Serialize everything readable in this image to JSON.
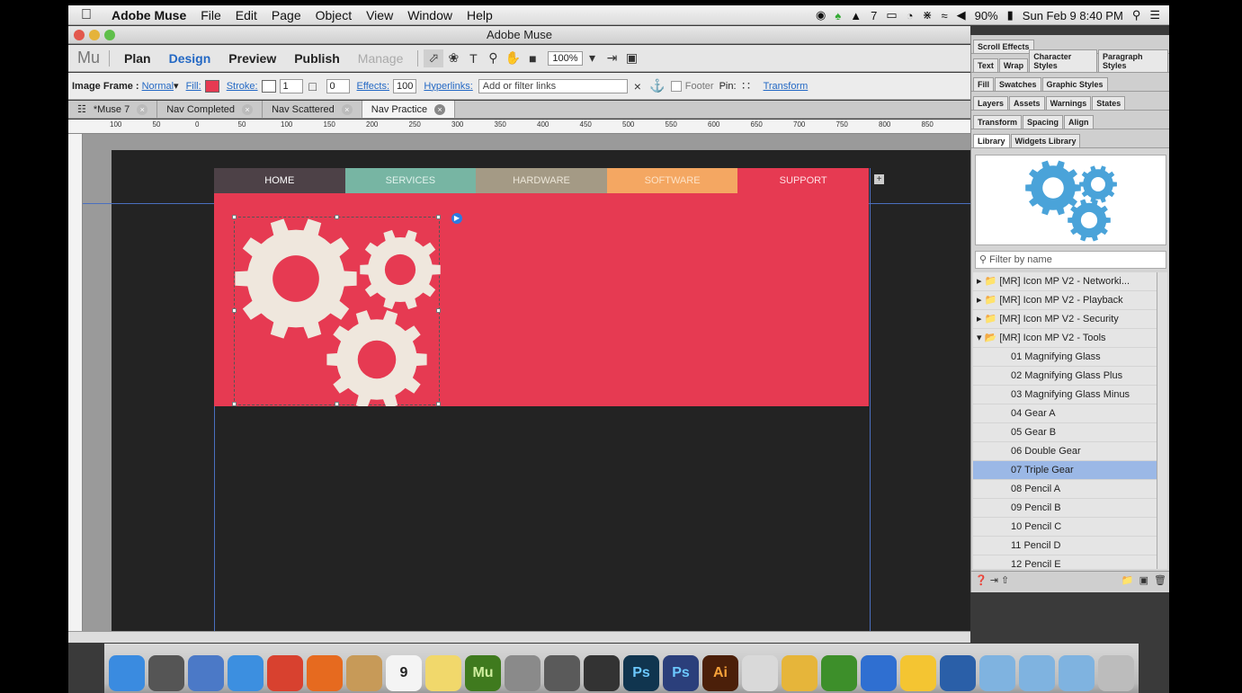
{
  "menubar": {
    "app_name": "Adobe Muse",
    "items": [
      "File",
      "Edit",
      "Page",
      "Object",
      "View",
      "Window",
      "Help"
    ],
    "status_text": "7",
    "battery": "90%",
    "clock": "Sun Feb 9  8:40 PM"
  },
  "window": {
    "title": "Adobe Muse"
  },
  "appbar": {
    "logo": "Mu",
    "tabs": [
      "Plan",
      "Design",
      "Preview",
      "Publish",
      "Manage"
    ],
    "zoom": "100%"
  },
  "ctrlbar": {
    "image_frame_label": "Image Frame :",
    "normal": "Normal",
    "fill": "Fill:",
    "stroke": "Stroke:",
    "stroke_value": "1",
    "corner_value": "0",
    "effects": "Effects:",
    "opacity": "100",
    "hyperlinks": "Hyperlinks:",
    "hyperlinks_placeholder": "Add or filter links",
    "footer": "Footer",
    "pin": "Pin:",
    "transform": "Transform"
  },
  "doctabs": [
    "*Muse 7",
    "Nav Completed",
    "Nav Scattered",
    "Nav Practice"
  ],
  "ruler_labels": [
    "100",
    "50",
    "0",
    "50",
    "100",
    "150",
    "200",
    "250",
    "300",
    "350",
    "400",
    "450",
    "500",
    "550",
    "600",
    "650",
    "700",
    "750",
    "800",
    "850"
  ],
  "site_nav": [
    {
      "label": "HOME",
      "color": "#4d4147",
      "text_color": "#ffffff"
    },
    {
      "label": "SERVICES",
      "color": "#77b5a3",
      "text_color": "#e0f2ec"
    },
    {
      "label": "HARDWARE",
      "color": "#a49a85",
      "text_color": "#ece6d8"
    },
    {
      "label": "SOFTWARE",
      "color": "#f4a762",
      "text_color": "#fde2c6"
    },
    {
      "label": "SUPPORT",
      "color": "#e63a52",
      "text_color": "#ffe0e4"
    }
  ],
  "colors": {
    "hero": "#e63a52",
    "gear": "#efe7dd",
    "preview_gear": "#4aa3d9",
    "selection": "#9bb8e6"
  },
  "panel": {
    "row1": [
      "Scroll Effects"
    ],
    "row2": [
      "Text",
      "Wrap",
      "Character Styles",
      "Paragraph Styles"
    ],
    "row3": [
      "Fill",
      "Swatches",
      "Graphic Styles"
    ],
    "row4": [
      "Layers",
      "Assets",
      "Warnings",
      "States"
    ],
    "row5": [
      "Transform",
      "Spacing",
      "Align"
    ],
    "row6": [
      "Library",
      "Widgets Library"
    ],
    "filter_placeholder": "Filter by name",
    "folders": [
      "[MR] Icon MP V2 - Networki...",
      "[MR] Icon MP V2 - Playback",
      "[MR] Icon MP V2 - Security",
      "[MR] Icon MP V2 - Tools"
    ],
    "items": [
      "01 Magnifying Glass",
      "02 Magnifying Glass Plus",
      "03 Magnifying Glass Minus",
      "04 Gear A",
      "05 Gear B",
      "06 Double Gear",
      "07 Triple Gear",
      "08 Pencil A",
      "09 Pencil B",
      "10 Pencil C",
      "11 Pencil D",
      "12 Pencil E"
    ],
    "selected_item": "07 Triple Gear"
  },
  "dock": [
    {
      "icon": "finder-icon",
      "color": "#3a8be0"
    },
    {
      "icon": "launchpad-icon",
      "color": "#555555"
    },
    {
      "icon": "preview-icon",
      "color": "#4b79c7"
    },
    {
      "icon": "safari-icon",
      "color": "#3c8fe0"
    },
    {
      "icon": "chrome-icon",
      "color": "#d8412f"
    },
    {
      "icon": "firefox-icon",
      "color": "#e66a1f"
    },
    {
      "icon": "contacts-icon",
      "color": "#c79a58"
    },
    {
      "icon": "calendar-icon",
      "color": "#f4f4f4"
    },
    {
      "icon": "stickies-icon",
      "color": "#f1d86b"
    },
    {
      "icon": "muse-icon",
      "color": "#3f7a1e"
    },
    {
      "icon": "calculator-icon",
      "color": "#8a8a8a"
    },
    {
      "icon": "final-cut-icon",
      "color": "#5a5a5a"
    },
    {
      "icon": "dvd-icon",
      "color": "#333333"
    },
    {
      "icon": "photoshop-icon",
      "color": "#10354f"
    },
    {
      "icon": "photoshop-elements-icon",
      "color": "#2b3f7b"
    },
    {
      "icon": "illustrator-icon",
      "color": "#4b1f09"
    },
    {
      "icon": "sketch-icon",
      "color": "#d9d9d9"
    },
    {
      "icon": "pages-icon",
      "color": "#e6b53a"
    },
    {
      "icon": "numbers-icon",
      "color": "#3d8f2a"
    },
    {
      "icon": "keynote-icon",
      "color": "#2f6fd1"
    },
    {
      "icon": "cyberduck-icon",
      "color": "#f4c532"
    },
    {
      "icon": "quicktime-icon",
      "color": "#2a5fa8"
    },
    {
      "icon": "folder-icon",
      "color": "#7fb3e0"
    },
    {
      "icon": "folder-icon",
      "color": "#7fb3e0"
    },
    {
      "icon": "folder-icon",
      "color": "#7fb3e0"
    },
    {
      "icon": "trash-icon",
      "color": "#bcbcbc"
    }
  ],
  "dock_labels": {
    "muse": "Mu",
    "ps": "Ps",
    "pse": "Ps",
    "ai": "Ai",
    "cal": "9"
  }
}
